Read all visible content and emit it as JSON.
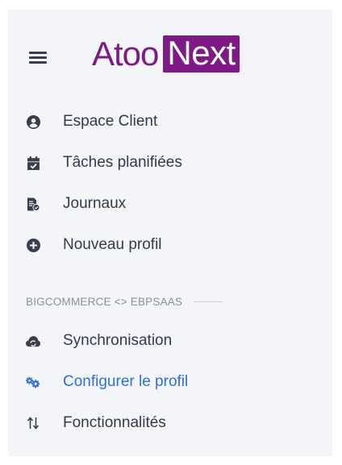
{
  "header": {
    "logo_part1": "Atoo",
    "logo_part2": "Next"
  },
  "colors": {
    "brand": "#7d1a86",
    "active": "#2f6fd6",
    "text": "#35394a",
    "section": "#8a8f9c",
    "background": "#f3f5f9"
  },
  "menu": {
    "items": [
      {
        "label": "Espace Client",
        "icon": "user-circle-icon"
      },
      {
        "label": "Tâches planifiées",
        "icon": "calendar-check-icon"
      },
      {
        "label": "Journaux",
        "icon": "file-log-icon"
      },
      {
        "label": "Nouveau profil",
        "icon": "plus-circle-icon"
      }
    ]
  },
  "section": {
    "title": "BIGCOMMERCE <> EBPSAAS",
    "items": [
      {
        "label": "Synchronisation",
        "icon": "cloud-sync-icon"
      },
      {
        "label": "Configurer le profil",
        "icon": "cogs-icon",
        "active": true
      },
      {
        "label": "Fonctionnalités",
        "icon": "sort-arrows-icon"
      }
    ]
  }
}
